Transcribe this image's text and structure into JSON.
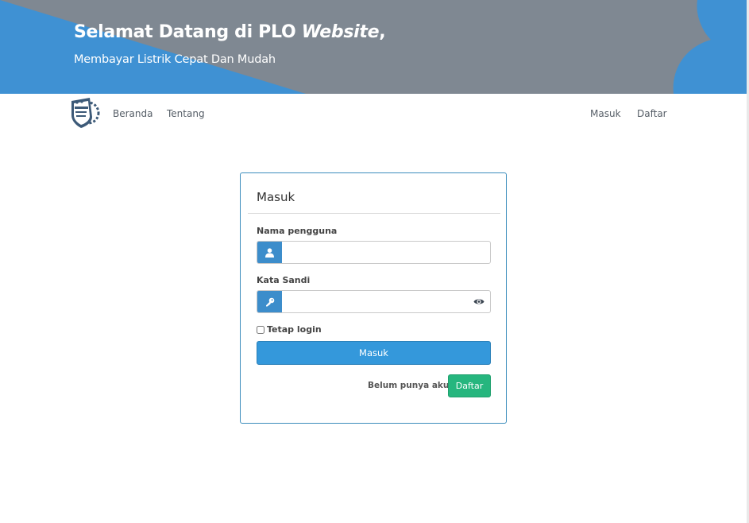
{
  "hero": {
    "title_prefix": "Selamat Datang di PLO ",
    "title_italic": "Website",
    "title_suffix": ",",
    "subtitle": "Membayar Listrik Cepat Dan Mudah"
  },
  "nav": {
    "left_links": [
      "Beranda",
      "Tentang"
    ],
    "right_links": [
      "Masuk",
      "Daftar"
    ]
  },
  "login_card": {
    "title": "Masuk",
    "username": {
      "label": "Nama pengguna",
      "value": "",
      "icon": "user-icon"
    },
    "password": {
      "label": "Kata Sandi",
      "value": "",
      "icon": "key-icon",
      "toggle_icon": "eye-icon"
    },
    "remember_label": "Tetap login",
    "remember_checked": false,
    "submit_label": "Masuk",
    "no_account_text": "Belum punya akun?",
    "register_label": "Daftar"
  },
  "colors": {
    "hero_gray": "#7f8892",
    "hero_blue": "#3f91d3",
    "primary": "#3498db",
    "success": "#26b67e",
    "card_border": "#3c8dbc"
  }
}
